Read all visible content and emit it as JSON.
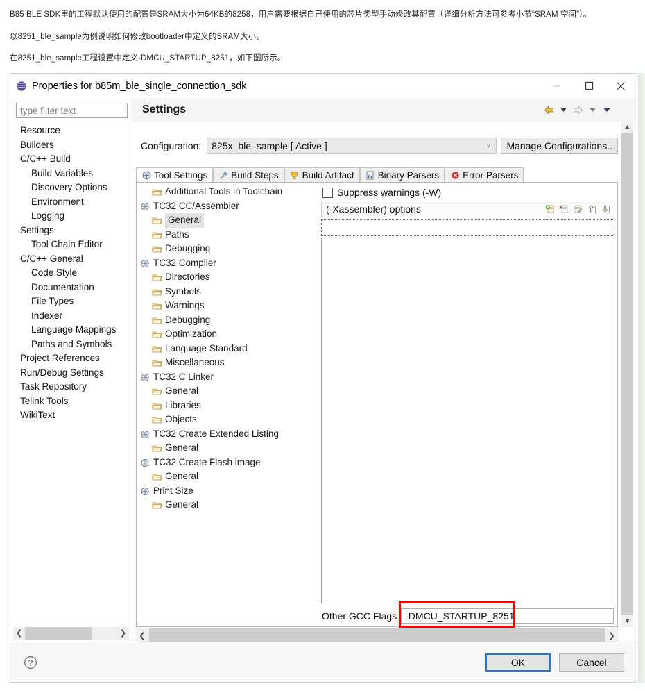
{
  "prose": {
    "paragraphs": [
      "B85 BLE SDK里的工程默认使用的配置是SRAM大小为64KB的8258，用户需要根据自己使用的芯片类型手动修改其配置（详细分析方法可参考小节“SRAM 空间”）。",
      "以8251_ble_sample为例说明如何修改bootloader中定义的SRAM大小。",
      "在8251_ble_sample工程设置中定义-DMCU_STARTUP_8251，如下图所示。"
    ]
  },
  "dialog": {
    "title": "Properties for b85m_ble_single_connection_sdk",
    "icon": "eclipse-properties-icon",
    "window_controls": {
      "minimize": "minimize-icon",
      "maximize": "maximize-icon",
      "close": "close-icon"
    }
  },
  "filter": {
    "placeholder": "type filter text",
    "value": ""
  },
  "tree": {
    "items": [
      {
        "label": "Resource",
        "level": 0,
        "selected": false
      },
      {
        "label": "Builders",
        "level": 0,
        "selected": false
      },
      {
        "label": "C/C++ Build",
        "level": 0,
        "selected": false
      },
      {
        "label": "Build Variables",
        "level": 1,
        "selected": false
      },
      {
        "label": "Discovery Options",
        "level": 1,
        "selected": false
      },
      {
        "label": "Environment",
        "level": 1,
        "selected": false
      },
      {
        "label": "Logging",
        "level": 1,
        "selected": false
      },
      {
        "label": "Settings",
        "level": 1,
        "selected": true
      },
      {
        "label": "Tool Chain Editor",
        "level": 1,
        "selected": false
      },
      {
        "label": "C/C++ General",
        "level": 0,
        "selected": false
      },
      {
        "label": "Code Style",
        "level": 1,
        "selected": false
      },
      {
        "label": "Documentation",
        "level": 1,
        "selected": false
      },
      {
        "label": "File Types",
        "level": 1,
        "selected": false
      },
      {
        "label": "Indexer",
        "level": 1,
        "selected": false
      },
      {
        "label": "Language Mappings",
        "level": 1,
        "selected": false
      },
      {
        "label": "Paths and Symbols",
        "level": 1,
        "selected": false
      },
      {
        "label": "Project References",
        "level": 0,
        "selected": false
      },
      {
        "label": "Run/Debug Settings",
        "level": 0,
        "selected": false
      },
      {
        "label": "Task Repository",
        "level": 0,
        "selected": false
      },
      {
        "label": "Telink Tools",
        "level": 0,
        "selected": false
      },
      {
        "label": "WikiText",
        "level": 0,
        "selected": false
      }
    ]
  },
  "page": {
    "title": "Settings",
    "nav": {
      "back": "back-arrow-icon",
      "back_menu": "back-dropdown-icon",
      "forward": "forward-arrow-icon",
      "forward_menu": "forward-dropdown-icon",
      "view_menu": "view-menu-icon"
    }
  },
  "configuration": {
    "label": "Configuration:",
    "value": "825x_ble_sample  [ Active ]",
    "dropdown_icon": "chevron-down-icon",
    "manage_button": "Manage Configurations.."
  },
  "tabs": [
    {
      "label": "Tool Settings",
      "icon": "tool-settings-icon",
      "active": true
    },
    {
      "label": "Build Steps",
      "icon": "build-steps-icon",
      "active": false
    },
    {
      "label": "Build Artifact",
      "icon": "build-artifact-icon",
      "active": false
    },
    {
      "label": "Binary Parsers",
      "icon": "binary-parsers-icon",
      "active": false
    },
    {
      "label": "Error Parsers",
      "icon": "error-parsers-icon",
      "active": false
    }
  ],
  "tool_tree": {
    "items": [
      {
        "label": "Additional Tools in Toolchain",
        "type": "folder",
        "child": true,
        "selected": false
      },
      {
        "label": "TC32 CC/Assembler",
        "type": "tool",
        "child": false,
        "selected": false
      },
      {
        "label": "General",
        "type": "folder",
        "child": true,
        "selected": true
      },
      {
        "label": "Paths",
        "type": "folder",
        "child": true,
        "selected": false
      },
      {
        "label": "Debugging",
        "type": "folder",
        "child": true,
        "selected": false
      },
      {
        "label": "TC32 Compiler",
        "type": "tool",
        "child": false,
        "selected": false
      },
      {
        "label": "Directories",
        "type": "folder",
        "child": true,
        "selected": false
      },
      {
        "label": "Symbols",
        "type": "folder",
        "child": true,
        "selected": false
      },
      {
        "label": "Warnings",
        "type": "folder",
        "child": true,
        "selected": false
      },
      {
        "label": "Debugging",
        "type": "folder",
        "child": true,
        "selected": false
      },
      {
        "label": "Optimization",
        "type": "folder",
        "child": true,
        "selected": false
      },
      {
        "label": "Language Standard",
        "type": "folder",
        "child": true,
        "selected": false
      },
      {
        "label": "Miscellaneous",
        "type": "folder",
        "child": true,
        "selected": false
      },
      {
        "label": "TC32 C Linker",
        "type": "tool",
        "child": false,
        "selected": false
      },
      {
        "label": "General",
        "type": "folder",
        "child": true,
        "selected": false
      },
      {
        "label": "Libraries",
        "type": "folder",
        "child": true,
        "selected": false
      },
      {
        "label": "Objects",
        "type": "folder",
        "child": true,
        "selected": false
      },
      {
        "label": "TC32 Create Extended Listing",
        "type": "tool",
        "child": false,
        "selected": false
      },
      {
        "label": "General",
        "type": "folder",
        "child": true,
        "selected": false
      },
      {
        "label": "TC32 Create Flash image",
        "type": "tool",
        "child": false,
        "selected": false
      },
      {
        "label": "General",
        "type": "folder",
        "child": true,
        "selected": false
      },
      {
        "label": "Print Size",
        "type": "tool",
        "child": false,
        "selected": false
      },
      {
        "label": "General",
        "type": "folder",
        "child": true,
        "selected": false
      }
    ]
  },
  "options_pane": {
    "suppress_warnings_label": "Suppress warnings (-W)",
    "suppress_warnings_checked": false,
    "options_header_label": "(-Xassembler) options",
    "option_entries": [],
    "toolbar_icons": [
      "add-icon",
      "delete-icon",
      "edit-icon",
      "move-up-icon",
      "move-down-icon"
    ]
  },
  "other_flags": {
    "label": "Other GCC Flags",
    "value": "-DMCU_STARTUP_8251",
    "highlight_color": "#fb0000"
  },
  "footer": {
    "help_icon": "help-icon",
    "ok_label": "OK",
    "cancel_label": "Cancel",
    "ok_focus_color": "#1f7ad1"
  },
  "scrollbars": {
    "left_h": "left-horizontal-scrollbar",
    "panes_h": "panes-horizontal-scrollbar",
    "right_v": "settings-vertical-scrollbar"
  }
}
